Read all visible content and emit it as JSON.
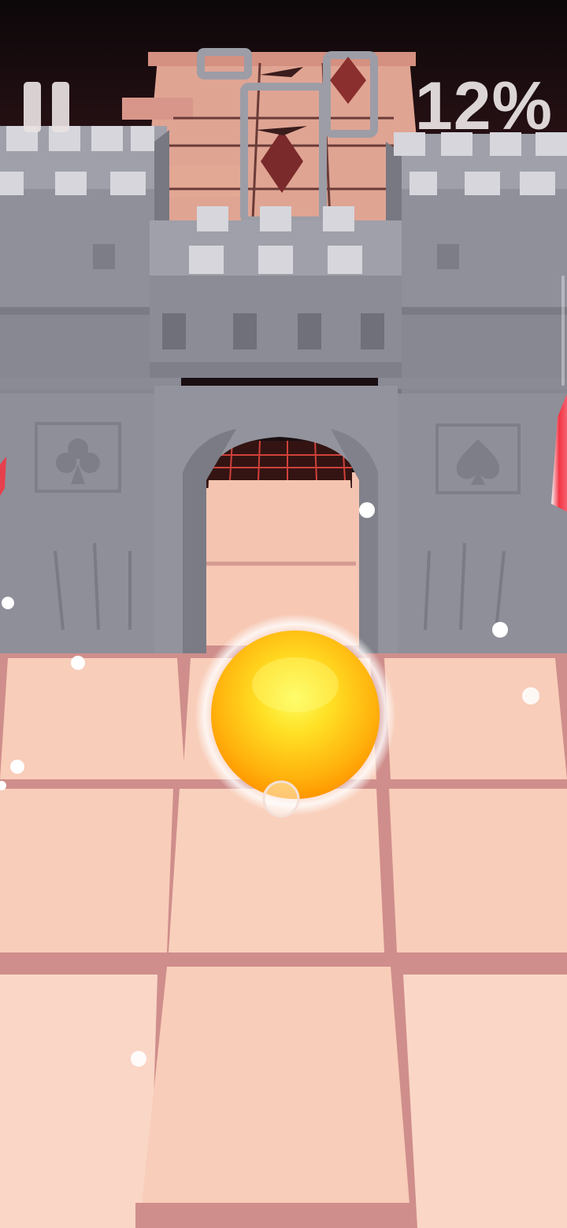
{
  "hud": {
    "progress_text": "12%",
    "progress_value": 0.12,
    "pause_icon": "pause-icon"
  },
  "scene": {
    "castle_emblems": [
      "club-icon",
      "spade-icon"
    ],
    "player": "yellow-ball",
    "colors": {
      "sky_top": "#120a0d",
      "tile": "#f8cdb9",
      "tile_grout": "#cf8e8b",
      "castle": "#8d8f99",
      "castle_light": "#a9aab2",
      "ball_core": "#fff23a",
      "ball_edge": "#ff9a00",
      "hazard": "#7a2a2a",
      "laser": "#ff2b3a"
    }
  }
}
